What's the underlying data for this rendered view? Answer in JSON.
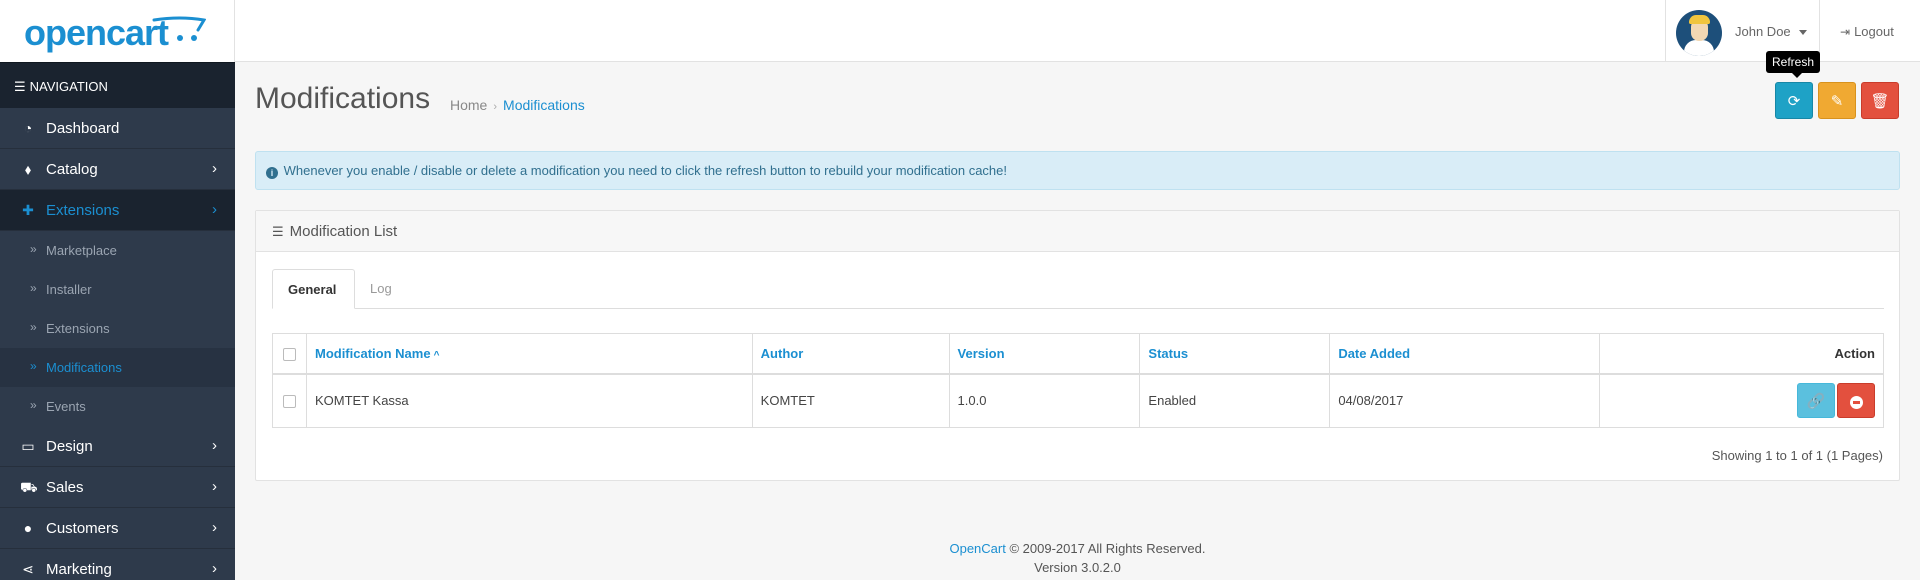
{
  "header": {
    "logo_text": "opencart",
    "user_name": "John Doe",
    "logout_label": "Logout"
  },
  "sidebar": {
    "nav_title": "NAVIGATION",
    "items": [
      {
        "label": "Dashboard",
        "icon": "dashboard-icon",
        "has_children": false
      },
      {
        "label": "Catalog",
        "icon": "tags-icon",
        "has_children": true
      },
      {
        "label": "Extensions",
        "icon": "puzzle-icon",
        "has_children": true,
        "active": true
      },
      {
        "label": "Design",
        "icon": "monitor-icon",
        "has_children": true
      },
      {
        "label": "Sales",
        "icon": "cart-icon",
        "has_children": true
      },
      {
        "label": "Customers",
        "icon": "user-icon",
        "has_children": true
      },
      {
        "label": "Marketing",
        "icon": "share-icon",
        "has_children": true
      }
    ],
    "extensions_children": [
      {
        "label": "Marketplace"
      },
      {
        "label": "Installer"
      },
      {
        "label": "Extensions"
      },
      {
        "label": "Modifications",
        "active": true
      },
      {
        "label": "Events"
      }
    ]
  },
  "page": {
    "title": "Modifications",
    "breadcrumb": [
      "Home",
      "Modifications"
    ],
    "tooltip": "Refresh",
    "alert": "Whenever you enable / disable or delete a modification you need to click the refresh button to rebuild your modification cache!"
  },
  "panel": {
    "heading": "Modification List",
    "tabs": [
      "General",
      "Log"
    ],
    "active_tab": "General",
    "columns": [
      "Modification Name",
      "Author",
      "Version",
      "Status",
      "Date Added",
      "Action"
    ],
    "sorted_column": "Modification Name",
    "rows": [
      {
        "name": "KOMTET Kassa",
        "author": "KOMTET",
        "version": "1.0.0",
        "status": "Enabled",
        "date_added": "04/08/2017"
      }
    ],
    "pagination_text": "Showing 1 to 1 of 1 (1 Pages)"
  },
  "footer": {
    "link": "OpenCart",
    "copyright": "© 2009-2017 All Rights Reserved.",
    "version": "Version 3.0.2.0"
  },
  "colors": {
    "brand": "#1b8fd1",
    "sidebar_bg": "#2e3a4b",
    "refresh_btn": "#1ea2c6",
    "clear_btn": "#f0a932",
    "delete_btn": "#e3503e"
  }
}
